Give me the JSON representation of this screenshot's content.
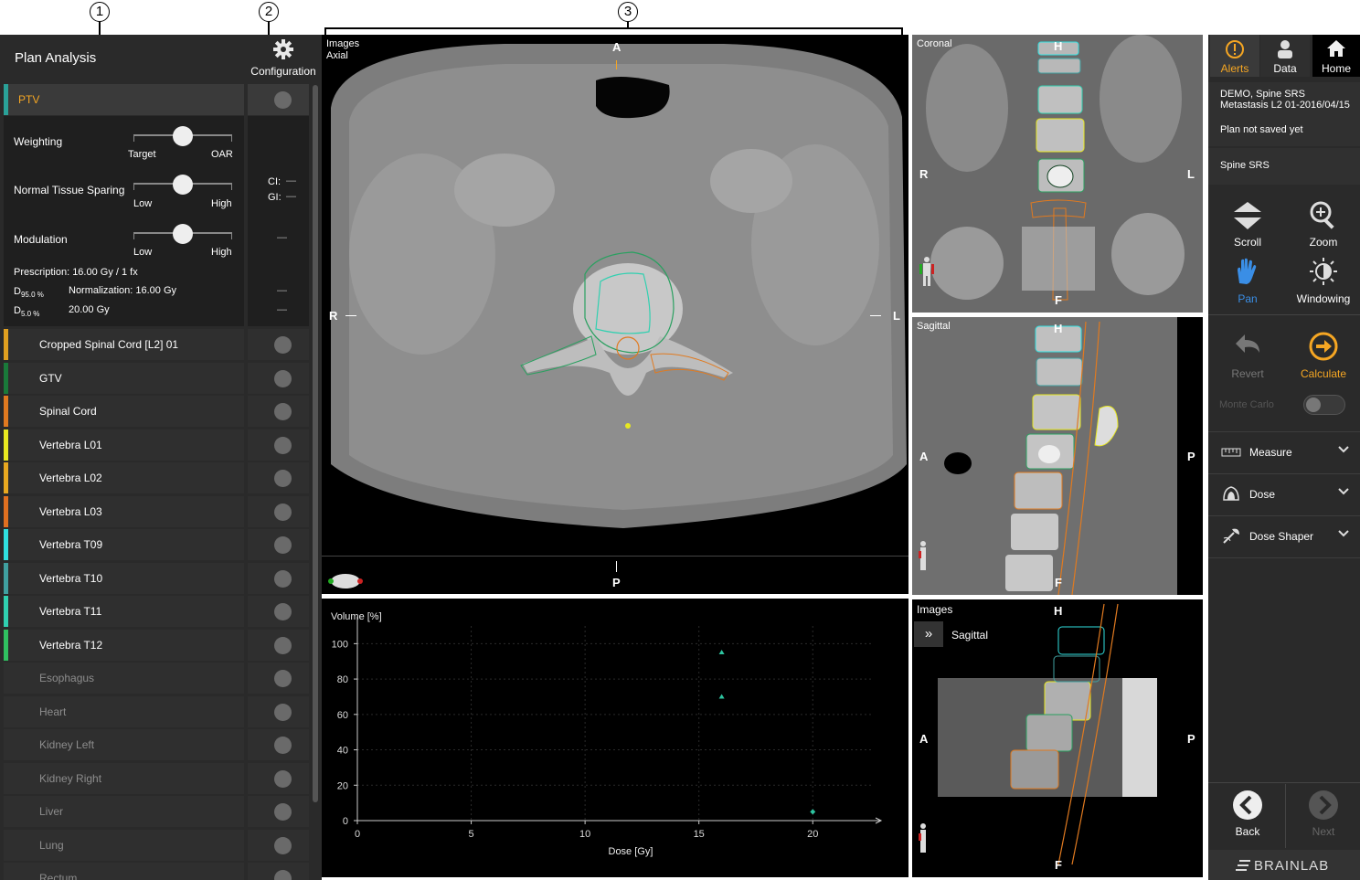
{
  "callouts": [
    "1",
    "2",
    "3"
  ],
  "left": {
    "title": "Plan Analysis",
    "config_label": "Configuration",
    "ptv_label": "PTV",
    "weighting_label": "Weighting",
    "weighting_left": "Target",
    "weighting_right": "OAR",
    "nts_label": "Normal Tissue Sparing",
    "nts_left": "Low",
    "nts_right": "High",
    "modulation_label": "Modulation",
    "mod_left": "Low",
    "mod_right": "High",
    "ci_label": "CI:",
    "gi_label": "GI:",
    "dash": "—",
    "prescription": "Prescription: 16.00 Gy / 1 fx",
    "d95_label": "D",
    "d95_sub": "95.0 %",
    "normalization": "Normalization: 16.00 Gy",
    "d5_label": "D",
    "d5_sub": "5.0 %",
    "d5_value": "20.00 Gy",
    "structures": [
      {
        "label": "Cropped Spinal Cord [L2] 01",
        "color": "#e0a020",
        "dim": false
      },
      {
        "label": "GTV",
        "color": "#1a7a3a",
        "dim": false
      },
      {
        "label": "Spinal Cord",
        "color": "#e07a20",
        "dim": false
      },
      {
        "label": "Vertebra L01",
        "color": "#e8e820",
        "dim": false
      },
      {
        "label": "Vertebra L02",
        "color": "#e8a820",
        "dim": false
      },
      {
        "label": "Vertebra L03",
        "color": "#e07020",
        "dim": false
      },
      {
        "label": "Vertebra T09",
        "color": "#30e0e0",
        "dim": false
      },
      {
        "label": "Vertebra T10",
        "color": "#40a0a0",
        "dim": false
      },
      {
        "label": "Vertebra T11",
        "color": "#30d0b0",
        "dim": false
      },
      {
        "label": "Vertebra T12",
        "color": "#30c060",
        "dim": false
      },
      {
        "label": "Esophagus",
        "color": "",
        "dim": true
      },
      {
        "label": "Heart",
        "color": "",
        "dim": true
      },
      {
        "label": "Kidney Left",
        "color": "",
        "dim": true
      },
      {
        "label": "Kidney Right",
        "color": "",
        "dim": true
      },
      {
        "label": "Liver",
        "color": "",
        "dim": true
      },
      {
        "label": "Lung",
        "color": "",
        "dim": true
      },
      {
        "label": "Rectum",
        "color": "",
        "dim": true
      }
    ]
  },
  "axial": {
    "title": "Images",
    "subtitle": "Axial",
    "orient_top": "A",
    "orient_bottom": "P",
    "orient_left": "R",
    "orient_right": "L"
  },
  "coronal": {
    "title": "Coronal",
    "orient_top": "H",
    "orient_bottom": "F",
    "orient_left": "R",
    "orient_right": "L"
  },
  "sagittal": {
    "title": "Sagittal",
    "orient_top": "H",
    "orient_bottom": "F",
    "orient_left": "A",
    "orient_right": "P"
  },
  "images_view": {
    "title": "Images",
    "mode": "Sagittal",
    "orient_top": "H",
    "orient_bottom": "F",
    "orient_left": "A",
    "orient_right": "P"
  },
  "chart_data": {
    "type": "scatter",
    "ylabel": "Volume [%]",
    "xlabel": "Dose [Gy]",
    "xlim": [
      0,
      23
    ],
    "ylim": [
      0,
      110
    ],
    "xticks": [
      0,
      5,
      10,
      15,
      20
    ],
    "yticks": [
      0,
      20,
      40,
      60,
      80,
      100
    ],
    "grid": true,
    "points": [
      {
        "x": 16,
        "y": 95,
        "marker": "triangle"
      },
      {
        "x": 16,
        "y": 70,
        "marker": "triangle"
      },
      {
        "x": 20,
        "y": 5,
        "marker": "diamond"
      }
    ],
    "color": "#2ec4a0"
  },
  "right": {
    "alerts_label": "Alerts",
    "data_label": "Data",
    "home_label": "Home",
    "patient_name": "DEMO, Spine SRS",
    "patient_plan": "Metastasis L2 01-2016/04/15",
    "save_status": "Plan not saved yet",
    "protocol": "Spine SRS",
    "scroll_label": "Scroll",
    "zoom_label": "Zoom",
    "pan_label": "Pan",
    "windowing_label": "Windowing",
    "revert_label": "Revert",
    "calculate_label": "Calculate",
    "monte_carlo_label": "Monte Carlo",
    "measure_label": "Measure",
    "dose_label": "Dose",
    "dose_shaper_label": "Dose Shaper",
    "back_label": "Back",
    "next_label": "Next",
    "brand": "BRAINLAB",
    "accent": "#f5a623",
    "active_blue": "#3a8ee6"
  }
}
